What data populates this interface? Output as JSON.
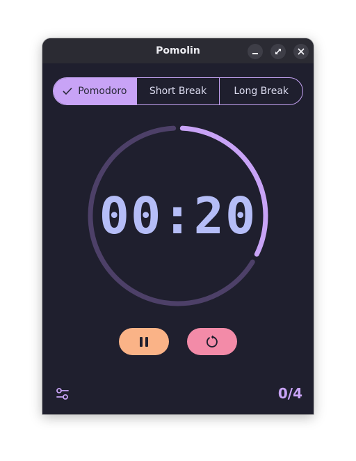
{
  "window": {
    "title": "Pomolin"
  },
  "modes": [
    {
      "label": "Pomodoro",
      "selected": true
    },
    {
      "label": "Short Break",
      "selected": false
    },
    {
      "label": "Long Break",
      "selected": false
    }
  ],
  "timer": {
    "display": "00:20",
    "progress_remaining": 0.33
  },
  "controls": {
    "pause_icon": "pause-icon",
    "reset_icon": "reset-icon",
    "settings_icon": "settings-sliders-icon"
  },
  "session_count": "0/4",
  "colors": {
    "background": "#1f1f2e",
    "accent": "#c8a3f6",
    "timer_text": "#b5bdf7",
    "ring_track": "#4d4068",
    "pause_button": "#fab387",
    "reset_button": "#f38ba8"
  }
}
